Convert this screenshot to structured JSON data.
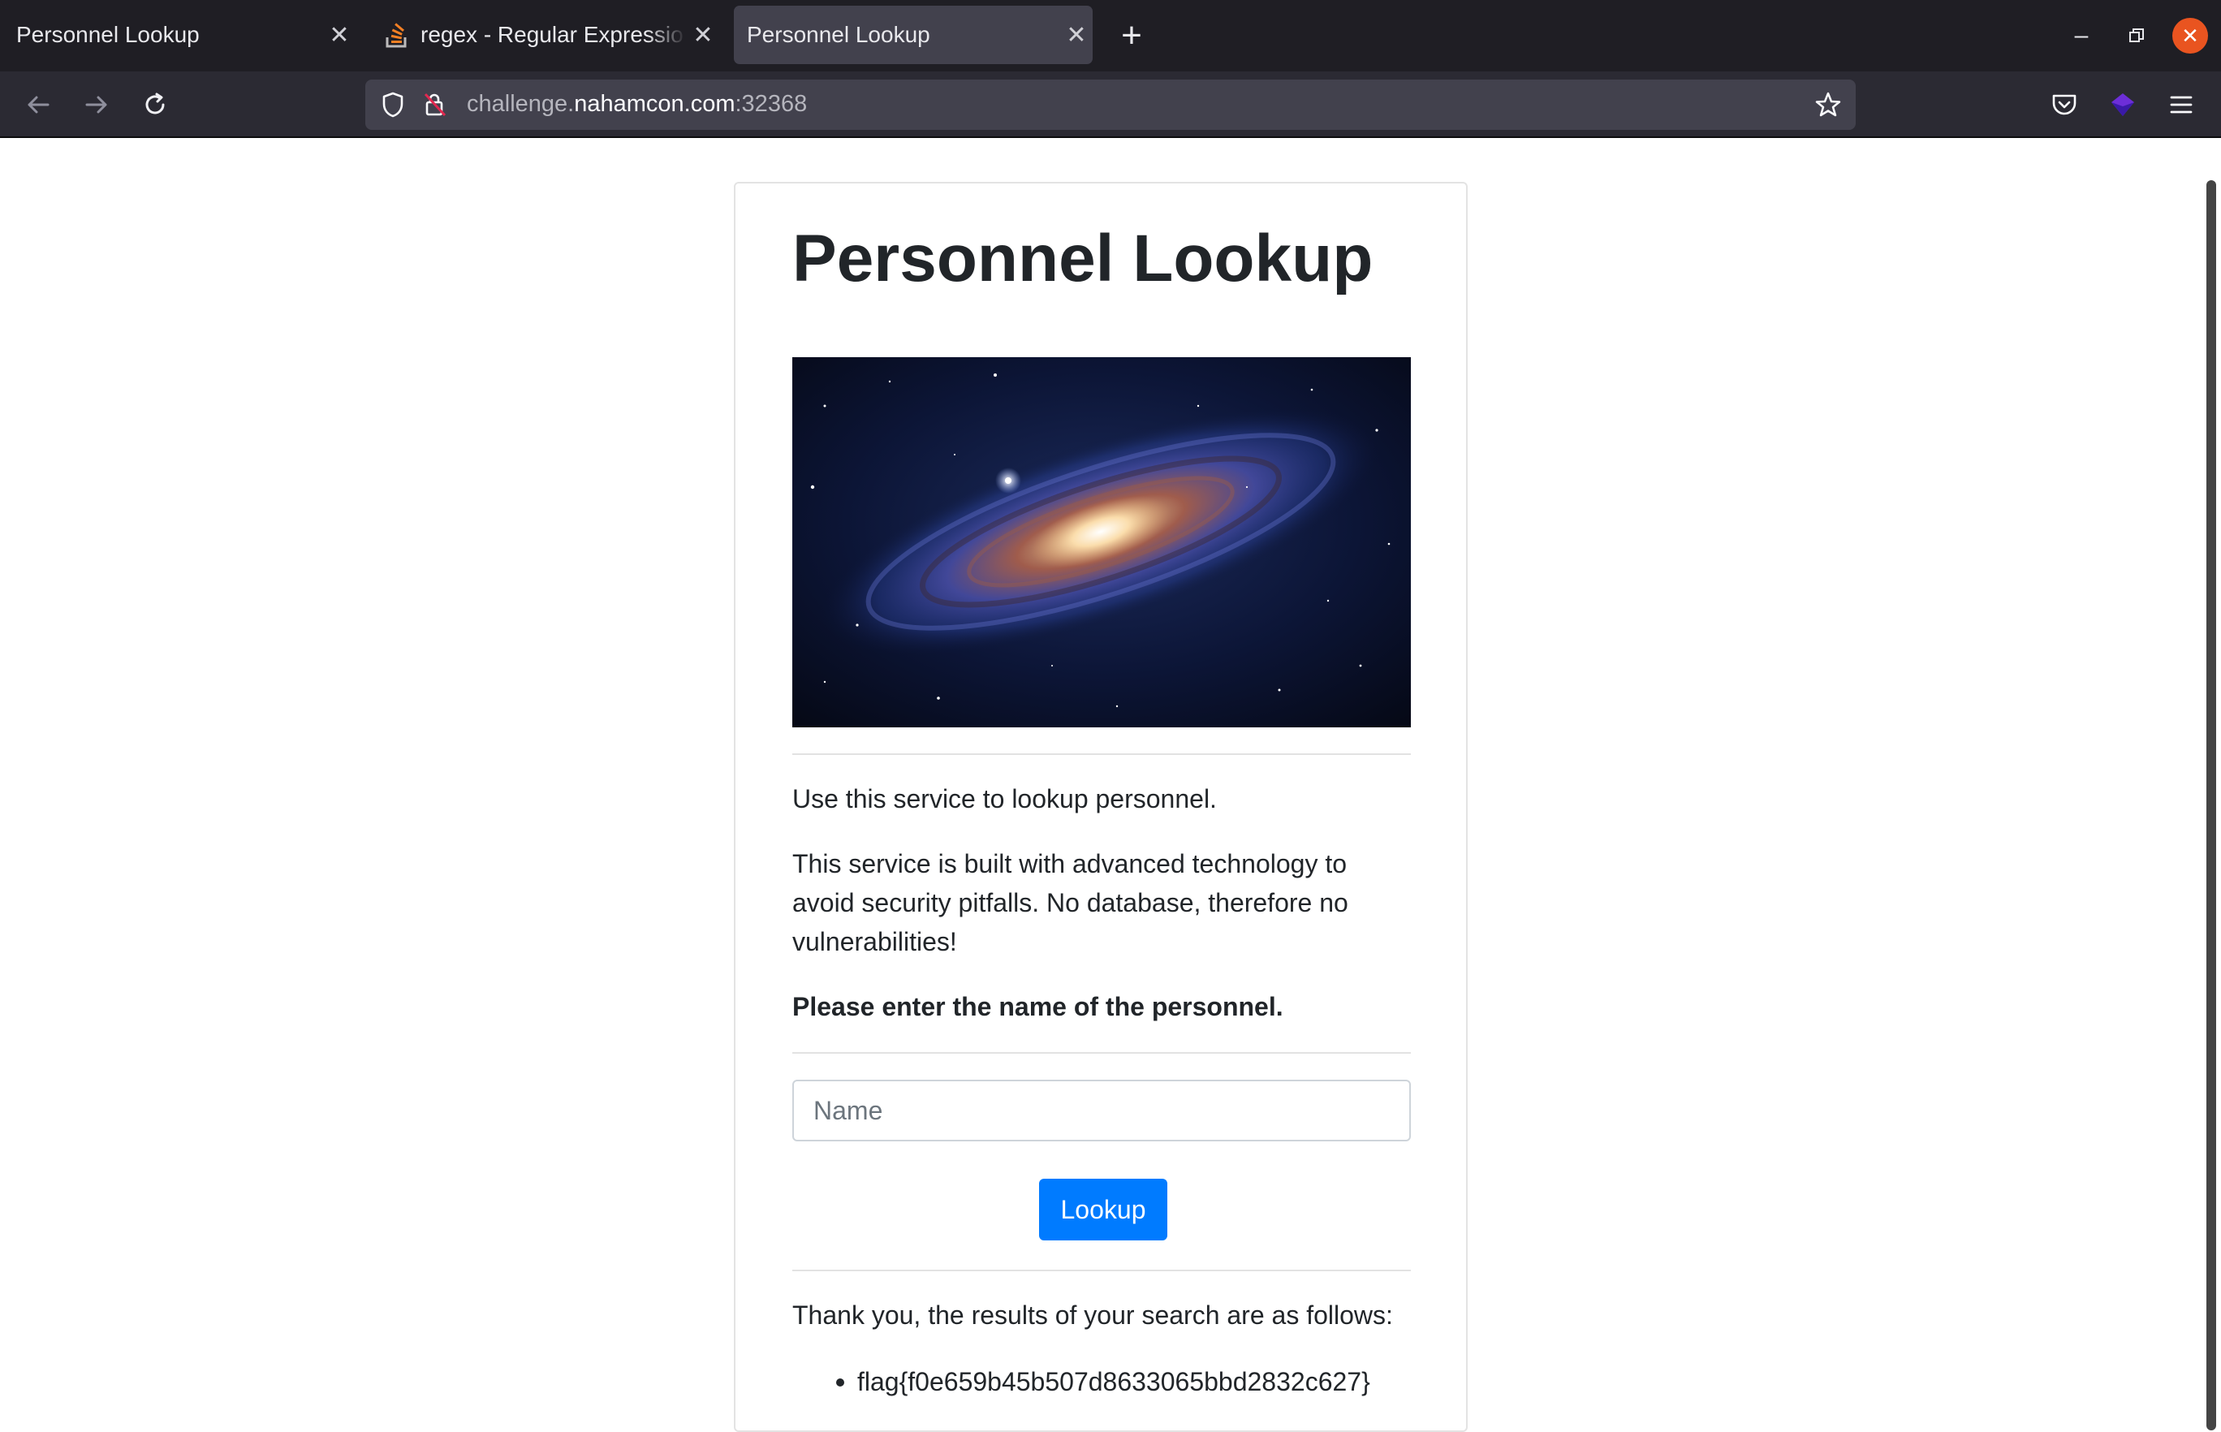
{
  "browser": {
    "tabs": [
      {
        "label": "Personnel Lookup",
        "favicon": "none",
        "active": false
      },
      {
        "label": "regex - Regular Expressio",
        "favicon": "stack-overflow-icon",
        "active": false
      },
      {
        "label": "Personnel Lookup",
        "favicon": "none",
        "active": true
      }
    ],
    "url": {
      "prefix": "challenge.",
      "host": "nahamcon.com",
      "suffix": ":32368"
    }
  },
  "page": {
    "title": "Personnel Lookup",
    "image": "galaxy-image",
    "intro": "Use this service to lookup personnel.",
    "description": "This service is built with advanced technology to avoid security pitfalls. No database, therefore no vulnerabilities!",
    "prompt": "Please enter the name of the personnel.",
    "name_placeholder": "Name",
    "name_value": "",
    "lookup_label": "Lookup",
    "results_heading": "Thank you, the results of your search are as follows:",
    "results": [
      "flag{f0e659b45b507d8633065bbd2832c627}"
    ]
  },
  "colors": {
    "primary_button": "#007bff",
    "close_button": "#e95420",
    "tabbar": "#1f1e24",
    "active_tab": "#42414d"
  }
}
